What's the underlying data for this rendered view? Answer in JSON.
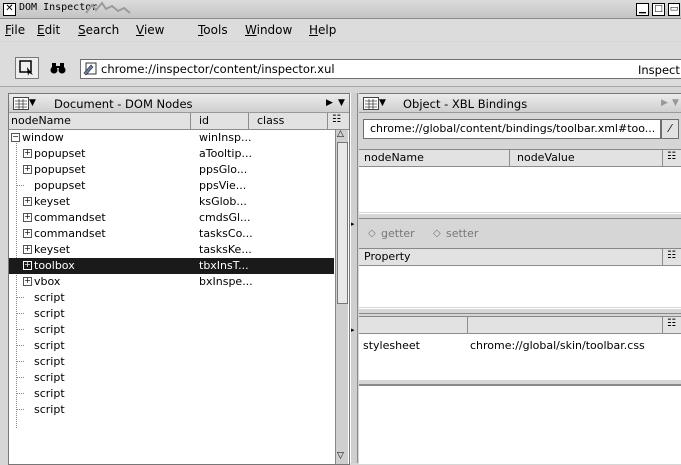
{
  "window": {
    "title": "DOM Inspector"
  },
  "menu": [
    "File",
    "Edit",
    "Search",
    "View",
    "Tools",
    "Window",
    "Help"
  ],
  "toolbar": {
    "url": "chrome://inspector/content/inspector.xul",
    "inspect_label": "Inspect"
  },
  "left_pane": {
    "title": "Document - DOM Nodes",
    "columns": [
      "nodeName",
      "id",
      "class"
    ],
    "rows": [
      {
        "name": "window",
        "id": "winInsp...",
        "twisty": "minus",
        "depth": 0
      },
      {
        "name": "popupset",
        "id": "aTooltip...",
        "twisty": "plus",
        "depth": 1
      },
      {
        "name": "popupset",
        "id": "ppsGlo...",
        "twisty": "plus",
        "depth": 1
      },
      {
        "name": "popupset",
        "id": "ppsVie...",
        "twisty": "none",
        "depth": 1
      },
      {
        "name": "keyset",
        "id": "ksGlob...",
        "twisty": "plus",
        "depth": 1
      },
      {
        "name": "commandset",
        "id": "cmdsGl...",
        "twisty": "plus",
        "depth": 1
      },
      {
        "name": "commandset",
        "id": "tasksCo...",
        "twisty": "plus",
        "depth": 1
      },
      {
        "name": "keyset",
        "id": "tasksKe...",
        "twisty": "plus",
        "depth": 1
      },
      {
        "name": "toolbox",
        "id": "tbxInsT...",
        "twisty": "plus",
        "depth": 1,
        "selected": true
      },
      {
        "name": "vbox",
        "id": "bxInspe...",
        "twisty": "plus",
        "depth": 1
      },
      {
        "name": "script",
        "id": "",
        "twisty": "none",
        "depth": 1
      },
      {
        "name": "script",
        "id": "",
        "twisty": "none",
        "depth": 1
      },
      {
        "name": "script",
        "id": "",
        "twisty": "none",
        "depth": 1
      },
      {
        "name": "script",
        "id": "",
        "twisty": "none",
        "depth": 1
      },
      {
        "name": "script",
        "id": "",
        "twisty": "none",
        "depth": 1
      },
      {
        "name": "script",
        "id": "",
        "twisty": "none",
        "depth": 1
      },
      {
        "name": "script",
        "id": "",
        "twisty": "none",
        "depth": 1
      },
      {
        "name": "script",
        "id": "",
        "twisty": "none",
        "depth": 1
      }
    ]
  },
  "right_pane": {
    "title": "Object - XBL Bindings",
    "binding_url": "chrome://global/content/bindings/toolbar.xml#too...",
    "content_columns": [
      "nodeName",
      "nodeValue"
    ],
    "getter_label": "getter",
    "setter_label": "setter",
    "property_column": "Property",
    "resource_rows": [
      {
        "name": "stylesheet",
        "value": "chrome://global/skin/toolbar.css"
      }
    ]
  }
}
